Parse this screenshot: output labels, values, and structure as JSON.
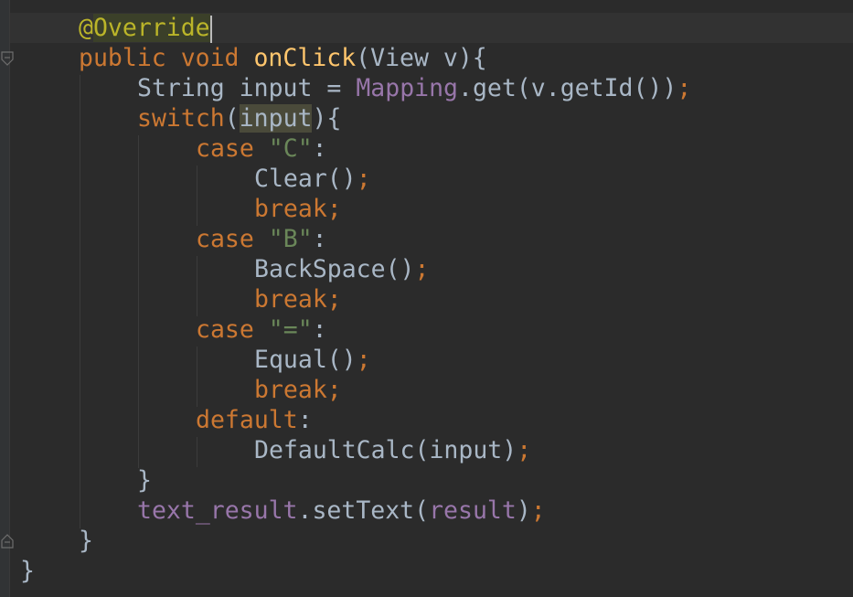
{
  "editor": {
    "lines": [
      {
        "indent": 2,
        "tokens": [
          {
            "t": "@",
            "c": "ann"
          },
          {
            "t": "Override",
            "c": "ann hl-ann"
          }
        ],
        "caret": true
      },
      {
        "indent": 2,
        "tokens": [
          {
            "t": "public ",
            "c": "kw"
          },
          {
            "t": "void ",
            "c": "kw"
          },
          {
            "t": "onClick",
            "c": "fn"
          },
          {
            "t": "(View v){",
            "c": "txt"
          }
        ]
      },
      {
        "indent": 4,
        "tokens": [
          {
            "t": "String input = ",
            "c": "txt"
          },
          {
            "t": "Mapping",
            "c": "fld"
          },
          {
            "t": ".get(v.getId())",
            "c": "txt"
          },
          {
            "t": ";",
            "c": "semi"
          }
        ]
      },
      {
        "indent": 4,
        "tokens": [
          {
            "t": "switch",
            "c": "kw"
          },
          {
            "t": "(",
            "c": "txt"
          },
          {
            "t": "input",
            "c": "txt hl-var"
          },
          {
            "t": "){",
            "c": "txt"
          }
        ]
      },
      {
        "indent": 6,
        "tokens": [
          {
            "t": "case ",
            "c": "kw"
          },
          {
            "t": "\"C\"",
            "c": "str"
          },
          {
            "t": ":",
            "c": "txt"
          }
        ]
      },
      {
        "indent": 8,
        "tokens": [
          {
            "t": "Clear()",
            "c": "txt"
          },
          {
            "t": ";",
            "c": "semi"
          }
        ]
      },
      {
        "indent": 8,
        "tokens": [
          {
            "t": "break;",
            "c": "kw"
          }
        ]
      },
      {
        "indent": 6,
        "tokens": [
          {
            "t": "case ",
            "c": "kw"
          },
          {
            "t": "\"B\"",
            "c": "str"
          },
          {
            "t": ":",
            "c": "txt"
          }
        ]
      },
      {
        "indent": 8,
        "tokens": [
          {
            "t": "BackSpace()",
            "c": "txt"
          },
          {
            "t": ";",
            "c": "semi"
          }
        ]
      },
      {
        "indent": 8,
        "tokens": [
          {
            "t": "break;",
            "c": "kw"
          }
        ]
      },
      {
        "indent": 6,
        "tokens": [
          {
            "t": "case ",
            "c": "kw"
          },
          {
            "t": "\"=\"",
            "c": "str"
          },
          {
            "t": ":",
            "c": "txt"
          }
        ]
      },
      {
        "indent": 8,
        "tokens": [
          {
            "t": "Equal()",
            "c": "txt"
          },
          {
            "t": ";",
            "c": "semi"
          }
        ]
      },
      {
        "indent": 8,
        "tokens": [
          {
            "t": "break;",
            "c": "kw"
          }
        ]
      },
      {
        "indent": 6,
        "tokens": [
          {
            "t": "default",
            "c": "kw"
          },
          {
            "t": ":",
            "c": "txt"
          }
        ]
      },
      {
        "indent": 8,
        "tokens": [
          {
            "t": "DefaultCalc(input)",
            "c": "txt"
          },
          {
            "t": ";",
            "c": "semi"
          }
        ]
      },
      {
        "indent": 4,
        "tokens": [
          {
            "t": "}",
            "c": "txt"
          }
        ]
      },
      {
        "indent": 4,
        "tokens": [
          {
            "t": "text_result",
            "c": "fld"
          },
          {
            "t": ".setText(",
            "c": "txt"
          },
          {
            "t": "result",
            "c": "fld"
          },
          {
            "t": ")",
            "c": "txt"
          },
          {
            "t": ";",
            "c": "semi"
          }
        ]
      },
      {
        "indent": 2,
        "tokens": [
          {
            "t": "}",
            "c": "txt"
          }
        ]
      },
      {
        "indent": 0,
        "tokens": [
          {
            "t": "}",
            "c": "txt"
          }
        ]
      }
    ]
  },
  "colors": {
    "background": "#2b2b2b",
    "keyword": "#cc7832",
    "method": "#ffc66d",
    "string": "#6a8759",
    "field": "#9876aa",
    "annotation": "#bbb529",
    "text": "#a9b7c6"
  },
  "icons": {
    "fold_open": "fold-open-icon",
    "fold_close": "fold-close-icon"
  }
}
